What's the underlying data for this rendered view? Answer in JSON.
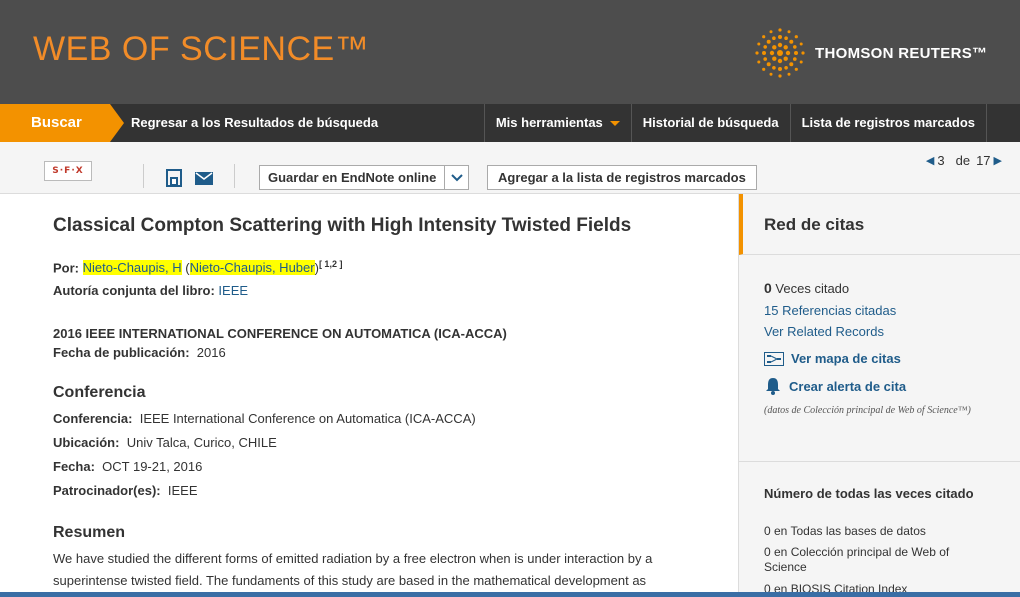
{
  "header": {
    "logo": "WEB OF SCIENCE™",
    "brand": "THOMSON REUTERS™"
  },
  "nav": {
    "search": "Buscar",
    "back": "Regresar a los Resultados de búsqueda",
    "tools": "Mis herramientas",
    "history": "Historial de búsqueda",
    "marked": "Lista de registros marcados"
  },
  "toolbar": {
    "sfx": "S·F·X",
    "endnote": "Guardar en EndNote online",
    "add_marked": "Agregar a la lista de registros marcados",
    "pager": {
      "current": "3",
      "of": "de",
      "total": "17"
    }
  },
  "record": {
    "title": "Classical Compton Scattering with High Intensity Twisted Fields",
    "by_label": "Por:",
    "author_short": "Nieto-Chaupis, H",
    "author_full": "Nieto-Chaupis, Huber",
    "author_refs": "[ 1,2 ]",
    "book_author_label": "Autoría conjunta del libro:",
    "book_author": "IEEE",
    "source": "2016 IEEE INTERNATIONAL CONFERENCE ON AUTOMATICA (ICA-ACCA)",
    "pub_date_label": "Fecha de publicación:",
    "pub_date": "2016",
    "conference_heading": "Conferencia",
    "conf_label": "Conferencia:",
    "conf_value": "IEEE International Conference on Automatica (ICA-ACCA)",
    "location_label": "Ubicación:",
    "location_value": "Univ Talca, Curico, CHILE",
    "date_label": "Fecha:",
    "date_value": "OCT 19-21, 2016",
    "sponsor_label": "Patrocinador(es):",
    "sponsor_value": "IEEE",
    "abstract_heading": "Resumen",
    "abstract": "We have studied the different forms of emitted radiation by a free electron when is under interaction by a superintense twisted field. The fundaments of this study are based in the mathematical development as"
  },
  "sidebar": {
    "title": "Red de citas",
    "times_cited_num": "0",
    "times_cited_label": "Veces citado",
    "refs": "15 Referencias citadas",
    "related": "Ver Related Records",
    "citation_map": "Ver mapa de citas",
    "alert": "Crear alerta de cita",
    "note": "(datos de Colección principal de Web of Science™)",
    "all_times_heading": "Número de todas las veces citado",
    "counts": [
      "0 en Todas las bases de datos",
      "0 en Colección principal de Web of Science",
      "0 en BIOSIS Citation Index"
    ]
  },
  "colors": {
    "header_bg": "#4d4d4d",
    "nav_bg": "#333333",
    "accent": "#f39200",
    "link": "#1f5c8a",
    "highlight": "#ffff00"
  }
}
